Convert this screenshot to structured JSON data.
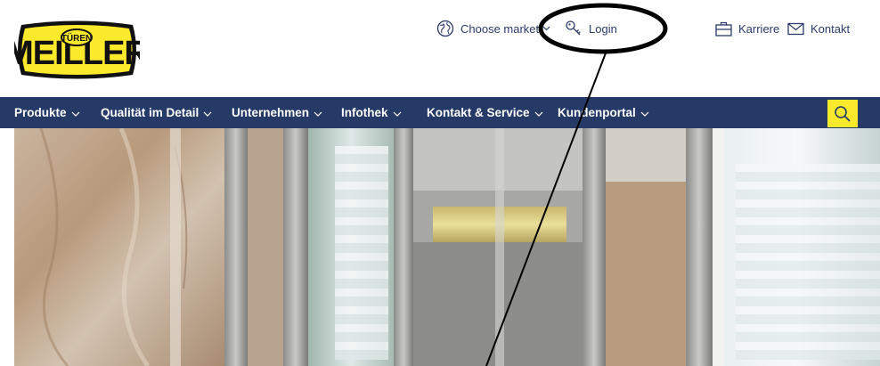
{
  "brand": {
    "logo_text": "MEILLER",
    "logo_sub": "TÜREN",
    "logo_color": "#fbe92c"
  },
  "topbar": {
    "market_label": "Choose market",
    "login_label": "Login",
    "karriere_label": "Karriere",
    "kontakt_label": "Kontakt",
    "icons": [
      "globe-icon",
      "key-icon",
      "briefcase-icon",
      "envelope-icon"
    ]
  },
  "nav": {
    "items": [
      {
        "label": "Produkte"
      },
      {
        "label": "Qualität im Detail"
      },
      {
        "label": "Unternehmen"
      },
      {
        "label": "Infothek"
      },
      {
        "label": "Kontakt & Service"
      },
      {
        "label": "Kundenportal"
      }
    ],
    "search_icon": "search-icon"
  },
  "colors": {
    "nav_bg": "#263a68",
    "accent_yellow": "#fbe92c",
    "text_dark": "#2b3a6b"
  }
}
